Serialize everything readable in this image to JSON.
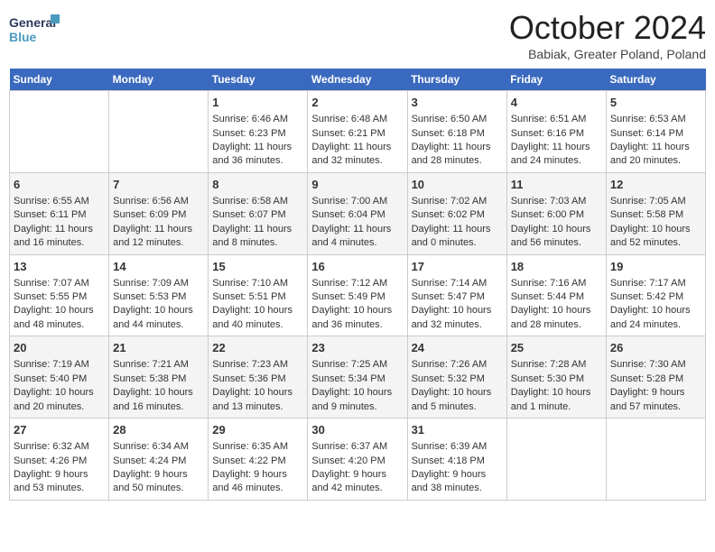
{
  "header": {
    "title": "October 2024",
    "location": "Babiak, Greater Poland, Poland",
    "logo_line1": "General",
    "logo_line2": "Blue"
  },
  "days_of_week": [
    "Sunday",
    "Monday",
    "Tuesday",
    "Wednesday",
    "Thursday",
    "Friday",
    "Saturday"
  ],
  "weeks": [
    [
      {
        "day": null,
        "sunrise": null,
        "sunset": null,
        "daylight": null
      },
      {
        "day": null,
        "sunrise": null,
        "sunset": null,
        "daylight": null
      },
      {
        "day": "1",
        "sunrise": "Sunrise: 6:46 AM",
        "sunset": "Sunset: 6:23 PM",
        "daylight": "Daylight: 11 hours and 36 minutes."
      },
      {
        "day": "2",
        "sunrise": "Sunrise: 6:48 AM",
        "sunset": "Sunset: 6:21 PM",
        "daylight": "Daylight: 11 hours and 32 minutes."
      },
      {
        "day": "3",
        "sunrise": "Sunrise: 6:50 AM",
        "sunset": "Sunset: 6:18 PM",
        "daylight": "Daylight: 11 hours and 28 minutes."
      },
      {
        "day": "4",
        "sunrise": "Sunrise: 6:51 AM",
        "sunset": "Sunset: 6:16 PM",
        "daylight": "Daylight: 11 hours and 24 minutes."
      },
      {
        "day": "5",
        "sunrise": "Sunrise: 6:53 AM",
        "sunset": "Sunset: 6:14 PM",
        "daylight": "Daylight: 11 hours and 20 minutes."
      }
    ],
    [
      {
        "day": "6",
        "sunrise": "Sunrise: 6:55 AM",
        "sunset": "Sunset: 6:11 PM",
        "daylight": "Daylight: 11 hours and 16 minutes."
      },
      {
        "day": "7",
        "sunrise": "Sunrise: 6:56 AM",
        "sunset": "Sunset: 6:09 PM",
        "daylight": "Daylight: 11 hours and 12 minutes."
      },
      {
        "day": "8",
        "sunrise": "Sunrise: 6:58 AM",
        "sunset": "Sunset: 6:07 PM",
        "daylight": "Daylight: 11 hours and 8 minutes."
      },
      {
        "day": "9",
        "sunrise": "Sunrise: 7:00 AM",
        "sunset": "Sunset: 6:04 PM",
        "daylight": "Daylight: 11 hours and 4 minutes."
      },
      {
        "day": "10",
        "sunrise": "Sunrise: 7:02 AM",
        "sunset": "Sunset: 6:02 PM",
        "daylight": "Daylight: 11 hours and 0 minutes."
      },
      {
        "day": "11",
        "sunrise": "Sunrise: 7:03 AM",
        "sunset": "Sunset: 6:00 PM",
        "daylight": "Daylight: 10 hours and 56 minutes."
      },
      {
        "day": "12",
        "sunrise": "Sunrise: 7:05 AM",
        "sunset": "Sunset: 5:58 PM",
        "daylight": "Daylight: 10 hours and 52 minutes."
      }
    ],
    [
      {
        "day": "13",
        "sunrise": "Sunrise: 7:07 AM",
        "sunset": "Sunset: 5:55 PM",
        "daylight": "Daylight: 10 hours and 48 minutes."
      },
      {
        "day": "14",
        "sunrise": "Sunrise: 7:09 AM",
        "sunset": "Sunset: 5:53 PM",
        "daylight": "Daylight: 10 hours and 44 minutes."
      },
      {
        "day": "15",
        "sunrise": "Sunrise: 7:10 AM",
        "sunset": "Sunset: 5:51 PM",
        "daylight": "Daylight: 10 hours and 40 minutes."
      },
      {
        "day": "16",
        "sunrise": "Sunrise: 7:12 AM",
        "sunset": "Sunset: 5:49 PM",
        "daylight": "Daylight: 10 hours and 36 minutes."
      },
      {
        "day": "17",
        "sunrise": "Sunrise: 7:14 AM",
        "sunset": "Sunset: 5:47 PM",
        "daylight": "Daylight: 10 hours and 32 minutes."
      },
      {
        "day": "18",
        "sunrise": "Sunrise: 7:16 AM",
        "sunset": "Sunset: 5:44 PM",
        "daylight": "Daylight: 10 hours and 28 minutes."
      },
      {
        "day": "19",
        "sunrise": "Sunrise: 7:17 AM",
        "sunset": "Sunset: 5:42 PM",
        "daylight": "Daylight: 10 hours and 24 minutes."
      }
    ],
    [
      {
        "day": "20",
        "sunrise": "Sunrise: 7:19 AM",
        "sunset": "Sunset: 5:40 PM",
        "daylight": "Daylight: 10 hours and 20 minutes."
      },
      {
        "day": "21",
        "sunrise": "Sunrise: 7:21 AM",
        "sunset": "Sunset: 5:38 PM",
        "daylight": "Daylight: 10 hours and 16 minutes."
      },
      {
        "day": "22",
        "sunrise": "Sunrise: 7:23 AM",
        "sunset": "Sunset: 5:36 PM",
        "daylight": "Daylight: 10 hours and 13 minutes."
      },
      {
        "day": "23",
        "sunrise": "Sunrise: 7:25 AM",
        "sunset": "Sunset: 5:34 PM",
        "daylight": "Daylight: 10 hours and 9 minutes."
      },
      {
        "day": "24",
        "sunrise": "Sunrise: 7:26 AM",
        "sunset": "Sunset: 5:32 PM",
        "daylight": "Daylight: 10 hours and 5 minutes."
      },
      {
        "day": "25",
        "sunrise": "Sunrise: 7:28 AM",
        "sunset": "Sunset: 5:30 PM",
        "daylight": "Daylight: 10 hours and 1 minute."
      },
      {
        "day": "26",
        "sunrise": "Sunrise: 7:30 AM",
        "sunset": "Sunset: 5:28 PM",
        "daylight": "Daylight: 9 hours and 57 minutes."
      }
    ],
    [
      {
        "day": "27",
        "sunrise": "Sunrise: 6:32 AM",
        "sunset": "Sunset: 4:26 PM",
        "daylight": "Daylight: 9 hours and 53 minutes."
      },
      {
        "day": "28",
        "sunrise": "Sunrise: 6:34 AM",
        "sunset": "Sunset: 4:24 PM",
        "daylight": "Daylight: 9 hours and 50 minutes."
      },
      {
        "day": "29",
        "sunrise": "Sunrise: 6:35 AM",
        "sunset": "Sunset: 4:22 PM",
        "daylight": "Daylight: 9 hours and 46 minutes."
      },
      {
        "day": "30",
        "sunrise": "Sunrise: 6:37 AM",
        "sunset": "Sunset: 4:20 PM",
        "daylight": "Daylight: 9 hours and 42 minutes."
      },
      {
        "day": "31",
        "sunrise": "Sunrise: 6:39 AM",
        "sunset": "Sunset: 4:18 PM",
        "daylight": "Daylight: 9 hours and 38 minutes."
      },
      {
        "day": null,
        "sunrise": null,
        "sunset": null,
        "daylight": null
      },
      {
        "day": null,
        "sunrise": null,
        "sunset": null,
        "daylight": null
      }
    ]
  ]
}
